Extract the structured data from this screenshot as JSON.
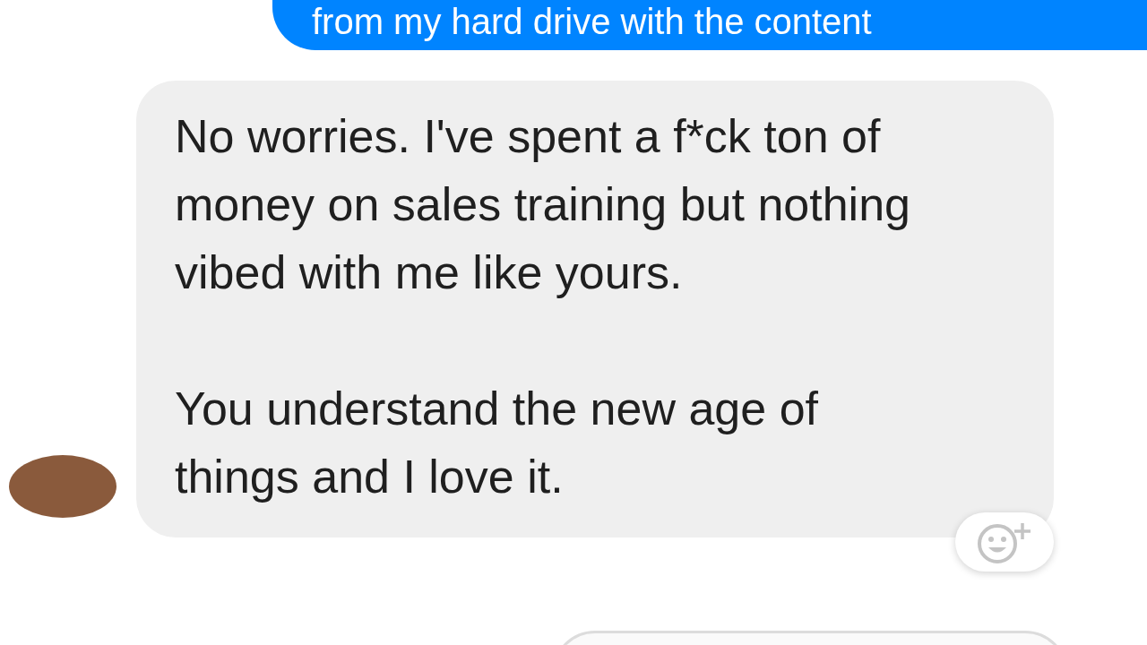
{
  "messages": [
    {
      "kind": "outgoing",
      "text": "from my hard drive with the content"
    },
    {
      "kind": "incoming",
      "text": "No worries. I've spent a f*ck ton of money on sales training but nothing vibed with me like yours.\n\nYou understand the new age of things and I love it.",
      "avatar": true,
      "reaction_button": true
    },
    {
      "kind": "outgoing-outline"
    }
  ]
}
